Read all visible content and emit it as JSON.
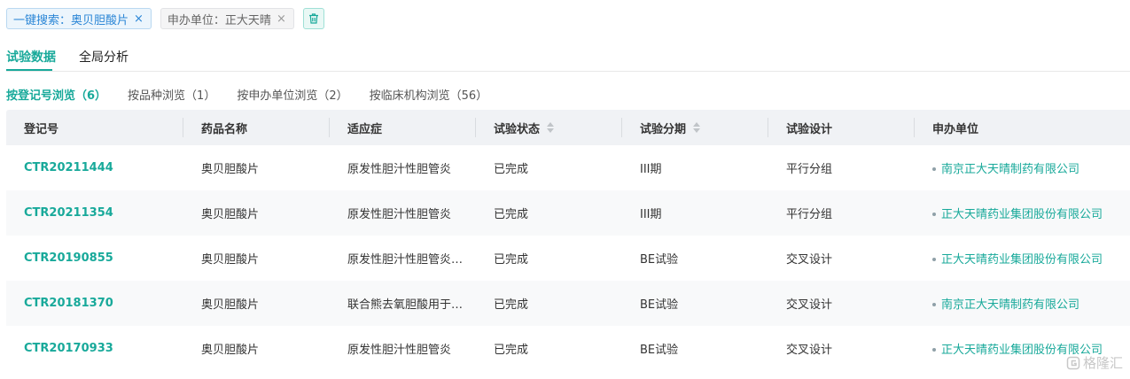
{
  "filters": {
    "chip1": {
      "label": "一键搜索：奥贝胆酸片",
      "close": "×"
    },
    "chip2": {
      "label": "申办单位：正大天晴",
      "close": "×"
    }
  },
  "tabs": [
    {
      "label": "试验数据",
      "active": true
    },
    {
      "label": "全局分析",
      "active": false
    }
  ],
  "subtabs": [
    {
      "label": "按登记号浏览（6）",
      "active": true
    },
    {
      "label": "按品种浏览（1）",
      "active": false
    },
    {
      "label": "按申办单位浏览（2）",
      "active": false
    },
    {
      "label": "按临床机构浏览（56）",
      "active": false
    }
  ],
  "table": {
    "headers": [
      "登记号",
      "药品名称",
      "适应症",
      "试验状态",
      "试验分期",
      "试验设计",
      "申办单位"
    ],
    "rows": [
      [
        "CTR20211444",
        "奥贝胆酸片",
        "原发性胆汁性胆管炎",
        "已完成",
        "III期",
        "平行分组",
        "南京正大天晴制药有限公司"
      ],
      [
        "CTR20211354",
        "奥贝胆酸片",
        "原发性胆汁性胆管炎",
        "已完成",
        "III期",
        "平行分组",
        "正大天晴药业集团股份有限公司"
      ],
      [
        "CTR20190855",
        "奥贝胆酸片",
        "原发性胆汁性胆管炎…",
        "已完成",
        "BE试验",
        "交叉设计",
        "正大天晴药业集团股份有限公司"
      ],
      [
        "CTR20181370",
        "奥贝胆酸片",
        "联合熊去氧胆酸用于…",
        "已完成",
        "BE试验",
        "交叉设计",
        "南京正大天晴制药有限公司"
      ],
      [
        "CTR20170933",
        "奥贝胆酸片",
        "原发性胆汁性胆管炎",
        "已完成",
        "BE试验",
        "交叉设计",
        "正大天晴药业集团股份有限公司"
      ]
    ]
  },
  "watermark": {
    "text": "格隆汇"
  },
  "colors": {
    "accent": "#18a99a",
    "chip_blue": "#2b86d6",
    "header_bg": "#f0f2f5"
  }
}
